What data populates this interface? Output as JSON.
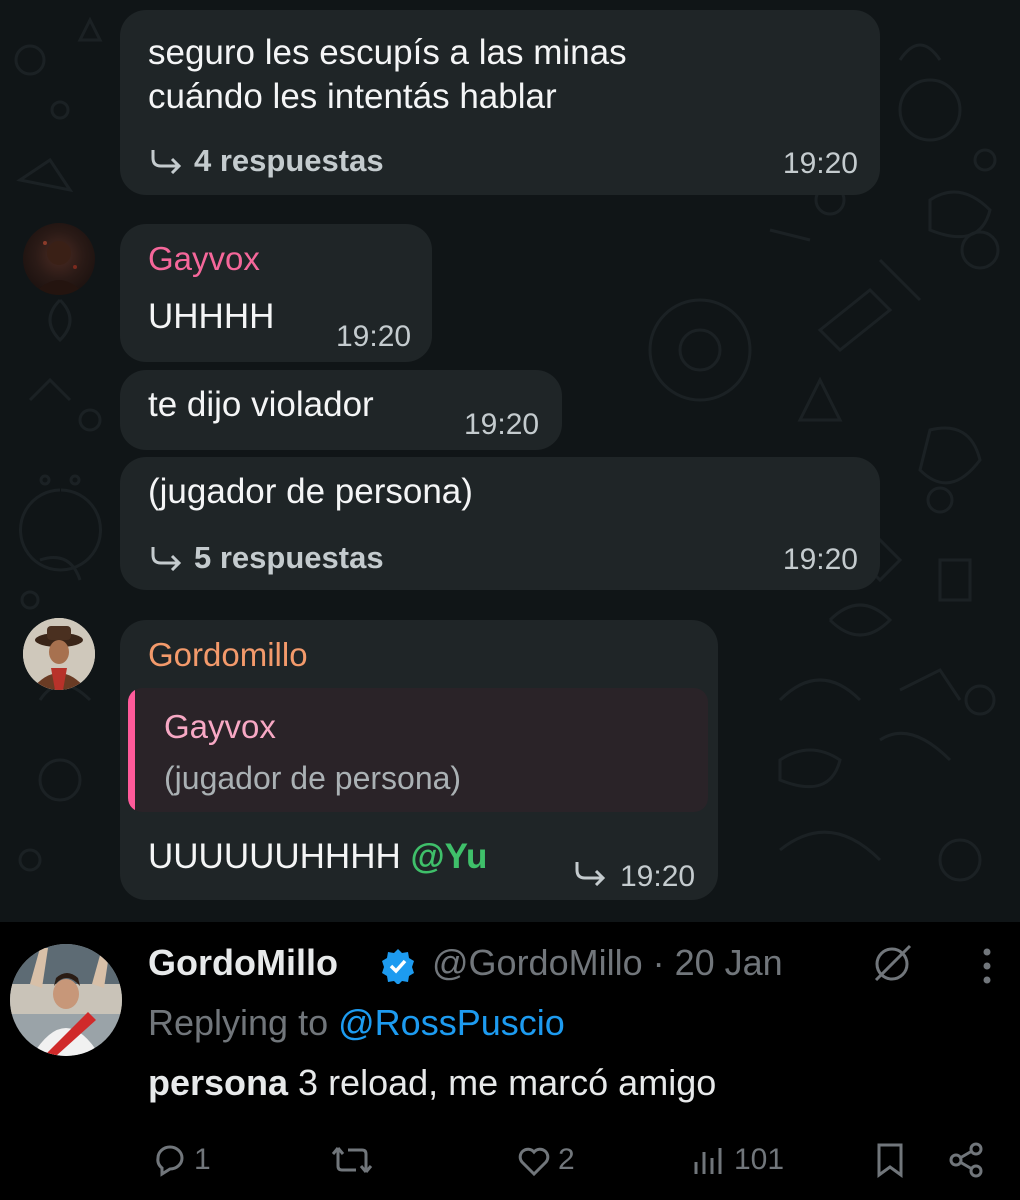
{
  "messages": {
    "m1": {
      "text_line1": "seguro les escupís a las minas",
      "text_line2": "cuándo les intentás hablar",
      "replies": "4 respuestas",
      "time": "19:20"
    },
    "m2": {
      "sender": "Gayvox",
      "text": "UHHHH",
      "time": "19:20"
    },
    "m3": {
      "text": "te dijo violador",
      "time": "19:20"
    },
    "m4": {
      "text": "(jugador de persona)",
      "replies": "5 respuestas",
      "time": "19:20"
    },
    "m5": {
      "sender": "Gordomillo",
      "quote_sender": "Gayvox",
      "quote_text": "(jugador de persona)",
      "text": "UUUUUUHHHH",
      "mention": "@Yu",
      "time": "19:20"
    }
  },
  "colors": {
    "gayvox_name": "#f5679a",
    "gordomillo_name": "#f39a6b",
    "mention": "#3fc06a",
    "twitter_link": "#1d9bf0",
    "verified": "#1d9bf0"
  },
  "tweet": {
    "display_name": "GordoMillo",
    "handle_date": "@GordoMillo · 20 Jan",
    "replying_prefix": "Replying to",
    "replying_to": "@RossPuscio",
    "body_bold": "persona",
    "body_rest": " 3 reload, me marcó amigo",
    "replies": "1",
    "retweets": "",
    "likes": "2",
    "views": "101"
  },
  "icons": [
    "reply-arrow-icon",
    "verified-badge-icon",
    "grok-icon",
    "more-icon",
    "comment-icon",
    "retweet-icon",
    "heart-icon",
    "views-icon",
    "bookmark-icon",
    "share-icon"
  ]
}
